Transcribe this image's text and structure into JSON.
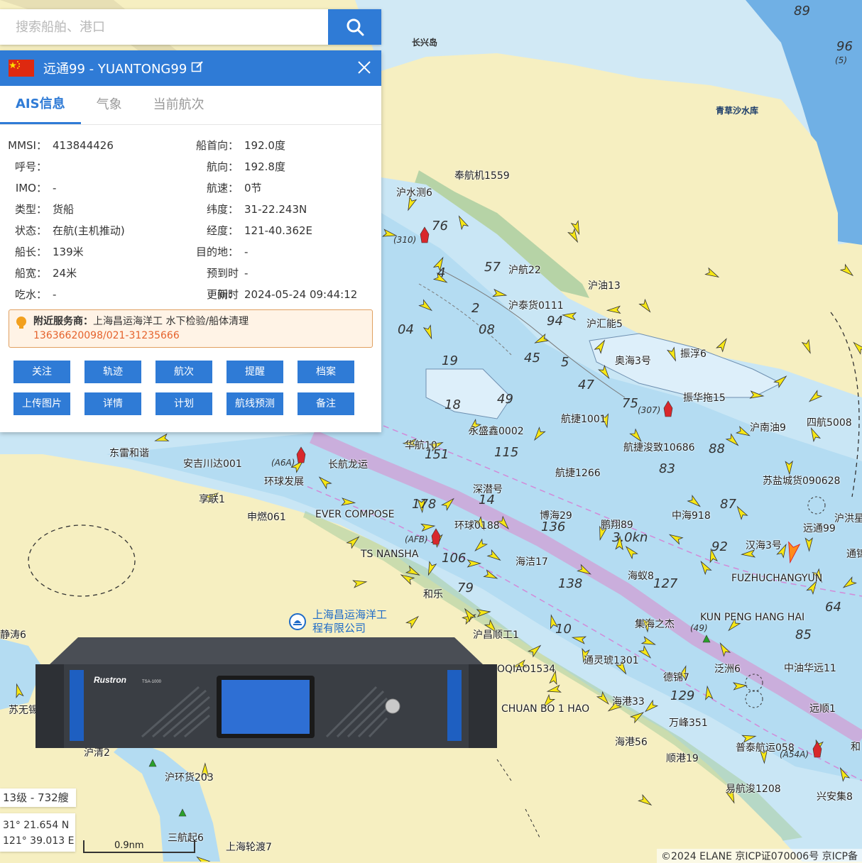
{
  "search": {
    "placeholder": "搜索船舶、港口"
  },
  "ship_panel": {
    "title": "远通99 - YUANTONG99",
    "tabs": [
      "AIS信息",
      "气象",
      "当前航次"
    ],
    "info_left": [
      {
        "label": "MMSI：",
        "value": "413844426"
      },
      {
        "label": "呼号：",
        "value": ""
      },
      {
        "label": "IMO：",
        "value": "-"
      },
      {
        "label": "类型：",
        "value": "货船"
      },
      {
        "label": "状态：",
        "value": "在航(主机推动)"
      },
      {
        "label": "船长：",
        "value": "139米"
      },
      {
        "label": "船宽：",
        "value": "24米"
      },
      {
        "label": "吃水：",
        "value": "-"
      }
    ],
    "info_right": [
      {
        "label": "船首向：",
        "value": "192.0度"
      },
      {
        "label": "航向：",
        "value": "192.8度"
      },
      {
        "label": "航速：",
        "value": "0节"
      },
      {
        "label": "纬度：",
        "value": "31-22.243N"
      },
      {
        "label": "经度：",
        "value": "121-40.362E"
      },
      {
        "label": "目的地：",
        "value": "-"
      },
      {
        "label": "预到时间：",
        "value": "-"
      },
      {
        "label": "更新时间：",
        "value": "2024-05-24 09:44:12"
      }
    ],
    "notice": {
      "label": "附近服务商：",
      "company": "上海昌运海洋工",
      "service": "水下检验/船体清理",
      "phone": "13636620098/021-31235666"
    },
    "buttons": [
      "关注",
      "轨迹",
      "航次",
      "提醒",
      "档案",
      "上传图片",
      "详情",
      "计划",
      "航线预测",
      "备注"
    ]
  },
  "status": {
    "level": "13级 - 732艘",
    "lat": "31° 21.654 N",
    "lon": "121° 39.013 E",
    "scale": "0.9nm",
    "copyright": "©2024 ELANE  京ICP证070006号  京ICP备"
  },
  "company_marker": {
    "line1": "上海昌运海洋工",
    "line2": "程有限公司"
  },
  "device": {
    "brand": "Rustron",
    "model": "TSA-1000"
  },
  "map_labels": {
    "places": [
      "长兴岛",
      "青草沙水库"
    ],
    "ships": [
      "奉航机1559",
      "沪水测6",
      "沪航22",
      "沪泰货0111",
      "沪油13",
      "沪汇能5",
      "奥海3号",
      "振浮6",
      "振华拖15",
      "航捷1001",
      "永盛鑫0002",
      "华航10",
      "沪南油9",
      "四航5008",
      "航捷浚致10686",
      "航捷1266",
      "长航龙运",
      "东雷和谐",
      "安吉川达001",
      "环球发展",
      "享联1",
      "申燃061",
      "EVER COMPOSE",
      "深潜号",
      "博海29",
      "鹏翔89",
      "中海918",
      "远通99",
      "汉海3号",
      "苏盐城货090628",
      "TS NANSHA",
      "环球0188",
      "海洁17",
      "和乐",
      "海蚁8",
      "FUZHUCHANGYUN",
      "沪昌顺工1",
      "集海之杰",
      "KUN PENG HANG HAI",
      "通灵琥1301",
      "泛洲6",
      "中油华远11",
      "德锦7",
      "海港33",
      "CHUAN BO 1 HAO",
      "万峰351",
      "远顺1",
      "海港56",
      "顺港19",
      "普泰航运058",
      "易航浚1208",
      "兴安集8",
      "沪环货203",
      "三航起6",
      "上海轮渡7",
      "静涛6",
      "苏无锡",
      "沪清2",
      "OQIAO1534",
      "沪洪星",
      "通锦",
      "和"
    ],
    "depths": [
      "89",
      "96",
      "76",
      "57",
      "4",
      "2",
      "04",
      "08",
      "94",
      "45",
      "5",
      "19",
      "18",
      "47",
      "49",
      "75",
      "83",
      "88",
      "115",
      "151",
      "178",
      "14",
      "136",
      "127",
      "106",
      "79",
      "138",
      "10",
      "64",
      "85",
      "129",
      "87",
      "92",
      "3.0kn",
      "(310)",
      "(307)",
      "(A6A)",
      "(AFB)",
      "(A54A)",
      "(5)",
      "(49)"
    ]
  }
}
